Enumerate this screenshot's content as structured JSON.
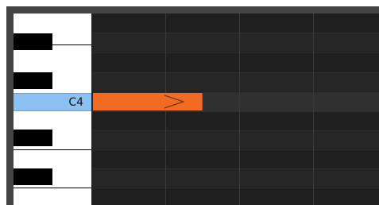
{
  "piano_roll": {
    "highlighted_key": {
      "label": "C4",
      "color": "#8cc2f3"
    },
    "note": {
      "pitch": "C4",
      "color": "#f26b22",
      "icon": "chevron-right-icon"
    },
    "colors": {
      "grid_background": "#222222",
      "frame": "#444444",
      "white_key": "#ffffff",
      "black_key": "#000000"
    }
  }
}
